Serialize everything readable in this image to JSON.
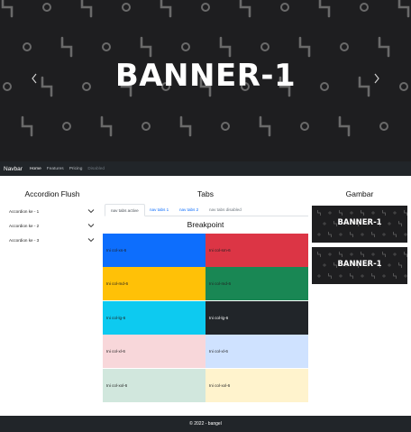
{
  "carousel": {
    "title": "BANNER-1",
    "prev_icon": "chevron-left-icon",
    "next_icon": "chevron-right-icon"
  },
  "navbar": {
    "brand": "Navbar",
    "links": [
      "Home",
      "Features",
      "Pricing",
      "Disabled"
    ]
  },
  "accordion": {
    "title": "Accordion Flush",
    "items": [
      "Accordion ke - 1",
      "Accordion ke - 2",
      "Accordion ke - 3"
    ]
  },
  "tabs": {
    "title": "Tabs",
    "items": [
      "nav tabs active",
      "nav tabs 1",
      "nav tabs 2",
      "nav tabs disabled"
    ]
  },
  "breakpoint": {
    "title": "Breakpoint",
    "cells": [
      "Ini col-xs-6",
      "Ini col-sm-6",
      "Ini col-md-6",
      "Ini col-md-6",
      "Ini col-lg-6",
      "Ini col-lg-6",
      "Ini col-xl-6",
      "Ini col-xl-6",
      "Ini col-xxl-6",
      "Ini col-xxl-6"
    ],
    "colors": [
      "#0d6efd",
      "#dc3545",
      "#ffc107",
      "#198754",
      "#0dcaf0",
      "#212529",
      "#f8d7da",
      "#cfe2ff",
      "#d1e7dd",
      "#fff3cd"
    ]
  },
  "gambar": {
    "title": "Gambar",
    "images": [
      "BANNER-1",
      "BANNER-1"
    ]
  },
  "footer": {
    "text": "© 2022 - bangel"
  }
}
